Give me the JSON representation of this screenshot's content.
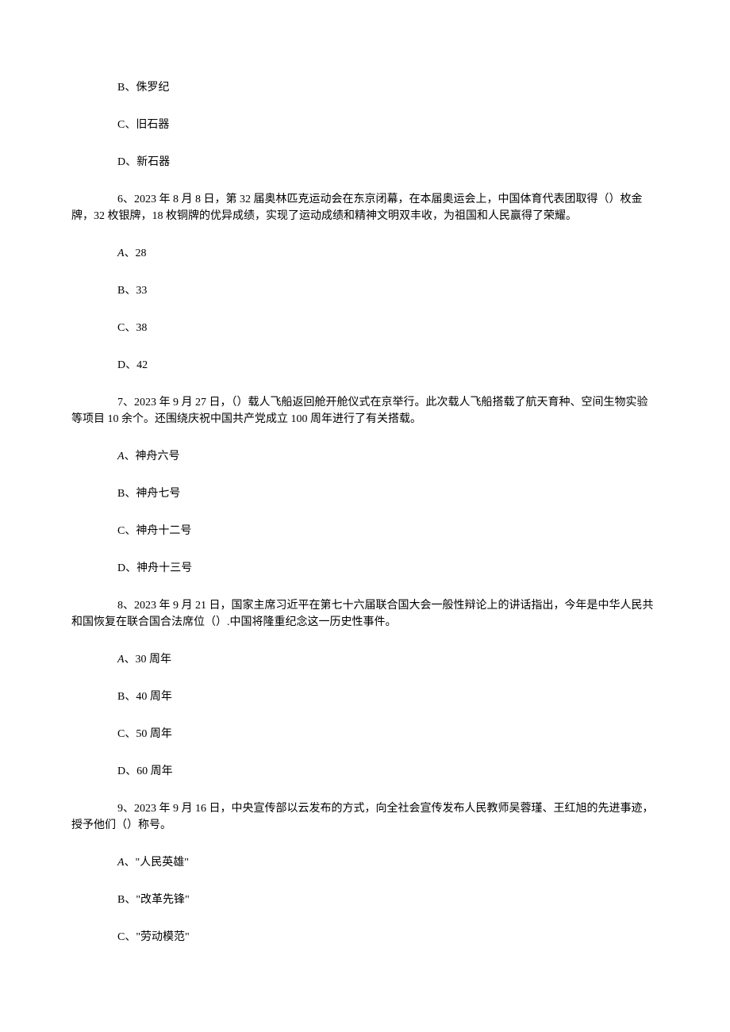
{
  "q5_options": {
    "b": "B、侏罗纪",
    "c": "C、旧石器",
    "d": "D、新石器"
  },
  "q6": {
    "text": "6、2023 年 8 月 8 日，第 32 届奥林匹克运动会在东京闭幕，在本届奥运会上，中国体育代表团取得（）枚金牌，32 枚银牌，18 枚铜牌的优异成绩，实现了运动成绩和精神文明双丰收，为祖国和人民赢得了荣耀。",
    "a_prefix": "A",
    "a_rest": "、28",
    "b": "B、33",
    "c": "C、38",
    "d": "D、42"
  },
  "q7": {
    "text": "7、2023 年 9 月 27 日，（）载人飞船返回舱开舱仪式在京举行。此次载人飞船搭载了航天育种、空间生物实验等项目 10 余个。还围绕庆祝中国共产党成立 100 周年进行了有关搭载。",
    "a_prefix": "A",
    "a_rest": "、神舟六号",
    "b": "B、神舟七号",
    "c": "C、神舟十二号",
    "d": "D、神舟十三号"
  },
  "q8": {
    "text": "8、2023 年 9 月 21 日，国家主席习近平在第七十六届联合国大会一般性辩论上的讲话指出，今年是中华人民共和国恢复在联合国合法席位（）.中国将隆重纪念这一历史性事件。",
    "a_prefix": "A",
    "a_rest": "、30 周年",
    "b": "B、40 周年",
    "c": "C、50 周年",
    "d": "D、60 周年"
  },
  "q9": {
    "text": "9、2023 年 9 月 16 日，中央宣传部以云发布的方式，向全社会宣传发布人民教师吴蓉瑾、王红旭的先进事迹，授予他们（）称号。",
    "a_prefix": "A",
    "a_rest": "、\"人民英雄\"",
    "b": "B、\"改革先锋\"",
    "c": "C、\"劳动模范\""
  }
}
